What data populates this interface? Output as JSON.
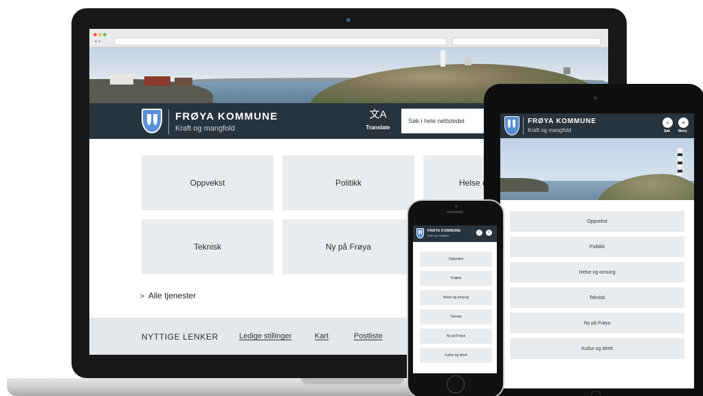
{
  "site": {
    "org_name": "FRØYA KOMMUNE",
    "tagline": "Kraft og mangfold",
    "translate_glyph": "文A",
    "translate_label": "Translate",
    "search_placeholder": "Søk i hele nettstedet"
  },
  "laptop": {
    "tiles": [
      "Oppvekst",
      "Politikk",
      "Helse og omsorg",
      "Teknisk",
      "Ny på Frøya"
    ],
    "all_services": "Alle tjenester",
    "useful_links": {
      "title": "NYTTIGE LENKER",
      "links": [
        "Ledige stillinger",
        "Kart",
        "Postliste"
      ]
    }
  },
  "tablet": {
    "search_icon": "search-icon",
    "search_label": "Søk",
    "menu_icon": "menu-icon",
    "menu_label": "Meny",
    "tiles": [
      "Oppvekst",
      "Politikk",
      "Helse og omsorg",
      "Teknisk",
      "Ny på Frøya",
      "Kultur og idrett"
    ]
  },
  "phone": {
    "org_name": "FRØYA KOMMUNE",
    "tagline": "Kraft og mangfold",
    "tiles": [
      "Oppvekst",
      "Politikk",
      "Helse og omsorg",
      "Teknisk",
      "Ny på Frøya",
      "Kultur og idrett"
    ]
  },
  "colors": {
    "header": "#27333d",
    "tile": "#e9ecee",
    "links_bar": "#e4e8ec",
    "shield": "#5a8fd4"
  }
}
